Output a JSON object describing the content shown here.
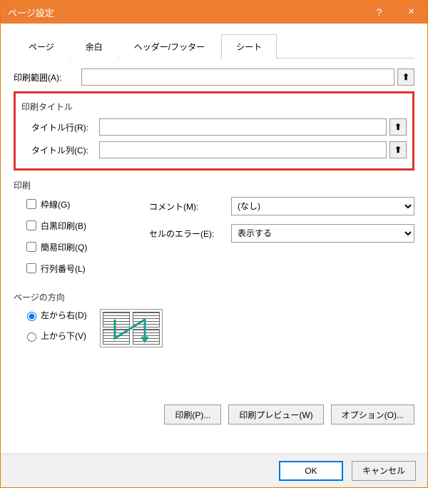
{
  "title": "ページ設定",
  "help": "?",
  "close": "×",
  "tabs": {
    "page": "ページ",
    "margins": "余白",
    "headerfooter": "ヘッダー/フッター",
    "sheet": "シート"
  },
  "printArea": {
    "label": "印刷範囲(A):",
    "value": ""
  },
  "printTitles": {
    "group": "印刷タイトル",
    "rows": {
      "label": "タイトル行(R):",
      "value": ""
    },
    "cols": {
      "label": "タイトル列(C):",
      "value": ""
    }
  },
  "print": {
    "group": "印刷",
    "gridlines": "枠線(G)",
    "bw": "白黒印刷(B)",
    "draft": "簡易印刷(Q)",
    "rowcol": "行列番号(L)",
    "comments": {
      "label": "コメント(M):",
      "value": "(なし)"
    },
    "errors": {
      "label": "セルのエラー(E):",
      "value": "表示する"
    }
  },
  "pageOrder": {
    "group": "ページの方向",
    "over": "左から右(D)",
    "down": "上から下(V)"
  },
  "buttons": {
    "print": "印刷(P)...",
    "preview": "印刷プレビュー(W)",
    "options": "オプション(O)...",
    "ok": "OK",
    "cancel": "キャンセル"
  },
  "collapseGlyph": "⬆"
}
